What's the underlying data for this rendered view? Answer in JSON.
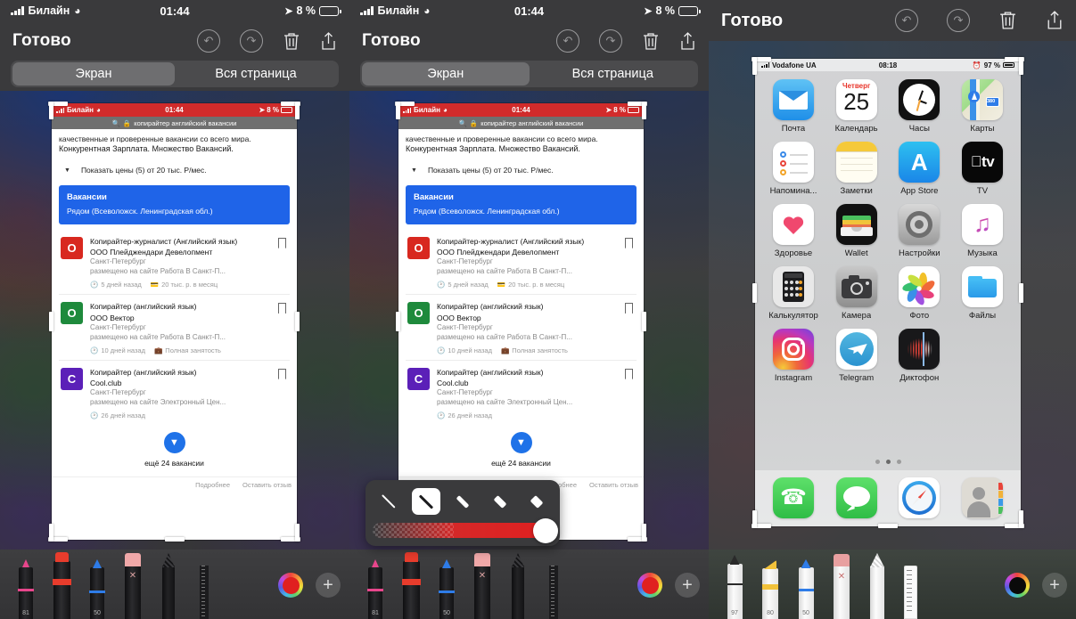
{
  "panels": [
    {
      "id": "panel-1",
      "status_bar": {
        "carrier": "Билайн",
        "time": "01:44",
        "battery": "8 %",
        "wifi_icon": "wifi-icon",
        "location_icon": "location-arrow-icon"
      },
      "nav": {
        "done_label": "Готово",
        "undo_icon": "undo-icon",
        "redo_icon": "redo-icon",
        "delete_icon": "trash-icon",
        "share_icon": "share-icon"
      },
      "segmented": {
        "options": [
          "Экран",
          "Вся страница"
        ],
        "selected": "Экран"
      },
      "screenshot_type": "browser-search-results",
      "markup_popup_visible": false,
      "toolbar_theme": "dark"
    },
    {
      "id": "panel-2",
      "status_bar": {
        "carrier": "Билайн",
        "time": "01:44",
        "battery": "8 %",
        "wifi_icon": "wifi-icon",
        "location_icon": "location-arrow-icon"
      },
      "nav": {
        "done_label": "Готово",
        "undo_icon": "undo-icon",
        "redo_icon": "redo-icon",
        "delete_icon": "trash-icon",
        "share_icon": "share-icon"
      },
      "segmented": {
        "options": [
          "Экран",
          "Вся страница"
        ],
        "selected": "Экран"
      },
      "screenshot_type": "browser-search-results",
      "markup_popup_visible": true,
      "toolbar_theme": "dark"
    },
    {
      "id": "panel-3",
      "nav": {
        "done_label": "Готово",
        "undo_icon": "undo-icon",
        "redo_icon": "redo-icon",
        "delete_icon": "trash-icon",
        "share_icon": "share-icon"
      },
      "screenshot_type": "ios-home-screen",
      "markup_popup_visible": false,
      "toolbar_theme": "olive"
    }
  ],
  "browser_shot": {
    "status_bar": {
      "carrier": "Билайн",
      "time": "01:44",
      "battery": "8 %"
    },
    "search_query": "копирайтер английский вакансии",
    "search_icon": "magnifier-icon",
    "lock_icon": "lock-icon",
    "clipped_line": "качественные и проверенные вакансии со всего мира.",
    "body_line": "Конкурентная Зарплата. Множество Вакансий.",
    "prices_label": "Показать цены (5) от 20 тыс. Р/мес.",
    "card": {
      "title": "Вакансии",
      "subtitle": "Рядом (Всеволожск. Ленинградская обл.)",
      "color": "#1f64e8"
    },
    "jobs": [
      {
        "logo_letter": "O",
        "logo_color": "#d8281f",
        "title": "Копирайтер-журналист (Английский язык)",
        "company": "ООО Плейджендари Девелопмент",
        "city": "Санкт-Петербург",
        "source": "размещено на сайте Работа В Санкт-П...",
        "time_ago": "5 дней назад",
        "extra": "20 тыс. р. в месяц",
        "extra_icon": "money-icon",
        "clock_icon": "clock-icon",
        "bookmark_icon": "bookmark-icon"
      },
      {
        "logo_letter": "O",
        "logo_color": "#1e8a3c",
        "title": "Копирайтер (английский язык)",
        "company": "ООО Вектор",
        "city": "Санкт-Петербург",
        "source": "размещено на сайте Работа В Санкт-П...",
        "time_ago": "10 дней назад",
        "extra": "Полная занятость",
        "extra_icon": "briefcase-icon",
        "clock_icon": "clock-icon",
        "bookmark_icon": "bookmark-icon"
      },
      {
        "logo_letter": "C",
        "logo_color": "#5b20b8",
        "title": "Копирайтер (английский язык)",
        "company": "Cool.club",
        "city": "Санкт-Петербург",
        "source": "размещено на сайте Электронный Цен...",
        "time_ago": "26 дней назад",
        "extra": "",
        "extra_icon": "",
        "clock_icon": "clock-icon",
        "bookmark_icon": "bookmark-icon"
      }
    ],
    "more_button_icon": "chevron-down-icon",
    "more_label": "ещё 24 вакансии",
    "footer": [
      "Подробнее",
      "Оставить отзыв"
    ]
  },
  "markup_popup": {
    "stroke_options": [
      "thin",
      "medium",
      "thick",
      "thicker",
      "thickest"
    ],
    "selected_index": 1,
    "opacity_slider": {
      "value": 100,
      "color": "#d62828"
    }
  },
  "home_screen": {
    "status_bar": {
      "carrier": "Vodafone UA",
      "time": "08:18",
      "battery": "97 %",
      "alarm_icon": "alarm-icon"
    },
    "rows": [
      [
        {
          "label": "Почта",
          "icon": "mail-icon"
        },
        {
          "label": "Календарь",
          "icon": "calendar-icon",
          "weekday": "Четверг",
          "day": "25"
        },
        {
          "label": "Часы",
          "icon": "clock-icon"
        },
        {
          "label": "Карты",
          "icon": "maps-icon"
        }
      ],
      [
        {
          "label": "Напомина...",
          "icon": "reminders-icon"
        },
        {
          "label": "Заметки",
          "icon": "notes-icon"
        },
        {
          "label": "App Store",
          "icon": "appstore-icon"
        },
        {
          "label": "TV",
          "icon": "appletv-icon"
        }
      ],
      [
        {
          "label": "Здоровье",
          "icon": "health-icon"
        },
        {
          "label": "Wallet",
          "icon": "wallet-icon"
        },
        {
          "label": "Настройки",
          "icon": "settings-gear-icon"
        },
        {
          "label": "Музыка",
          "icon": "music-icon"
        }
      ],
      [
        {
          "label": "Калькулятор",
          "icon": "calculator-icon"
        },
        {
          "label": "Камера",
          "icon": "camera-icon"
        },
        {
          "label": "Фото",
          "icon": "photos-icon"
        },
        {
          "label": "Файлы",
          "icon": "files-icon"
        }
      ],
      [
        {
          "label": "Instagram",
          "icon": "instagram-icon"
        },
        {
          "label": "Telegram",
          "icon": "telegram-icon"
        },
        {
          "label": "Диктофон",
          "icon": "voice-memos-icon"
        }
      ]
    ],
    "page_dots": {
      "count": 3,
      "active_index": 1
    },
    "dock": [
      {
        "label": "Телефон",
        "icon": "phone-icon"
      },
      {
        "label": "Сообщения",
        "icon": "messages-icon"
      },
      {
        "label": "Safari",
        "icon": "safari-icon"
      },
      {
        "label": "Контакты",
        "icon": "contacts-icon"
      }
    ]
  },
  "pen_toolbar_dark": {
    "pens": [
      {
        "name": "pen-tool",
        "number": "81",
        "tip_color": "#e8468c",
        "body_color": "#1d1d1f"
      },
      {
        "name": "highlighter-tool",
        "number": "",
        "tip_color": "#e83c2c",
        "body_color": "#1d1d1f"
      },
      {
        "name": "marker-tool",
        "number": "50",
        "tip_color": "#2e7ce8",
        "body_color": "#1d1d1f"
      },
      {
        "name": "eraser-tool",
        "number": "",
        "tip_color": "#f0a8a8",
        "body_color": "#1d1d1f"
      },
      {
        "name": "lasso-tool",
        "number": "",
        "tip_color": "#2a2a2c",
        "body_color": "#1d1d1f"
      },
      {
        "name": "ruler-tool",
        "number": "",
        "tip_color": "#222224",
        "body_color": "#1d1d1f"
      }
    ],
    "color_swatch": "#e02020",
    "add_icon": "plus-icon"
  },
  "pen_toolbar_light": {
    "pens": [
      {
        "name": "pen-tool",
        "number": "97",
        "tip_color": "#2a2a2a",
        "body_color": "#f2f2f2"
      },
      {
        "name": "highlighter-tool",
        "number": "80",
        "tip_color": "#f2c23a",
        "body_color": "#f4f4f4"
      },
      {
        "name": "marker-tool",
        "number": "50",
        "tip_color": "#2e7ce8",
        "body_color": "#f4f4f4"
      },
      {
        "name": "eraser-tool",
        "number": "",
        "tip_color": "#e8a0a0",
        "body_color": "#f2f2f2"
      },
      {
        "name": "lasso-tool",
        "number": "",
        "tip_color": "#e8e8e8",
        "body_color": "#f4f4f4"
      },
      {
        "name": "ruler-tool",
        "number": "",
        "tip_color": "#f0f0f0",
        "body_color": "#f6f6f6"
      }
    ],
    "color_swatch": "#0a0a0a",
    "add_icon": "plus-icon"
  }
}
